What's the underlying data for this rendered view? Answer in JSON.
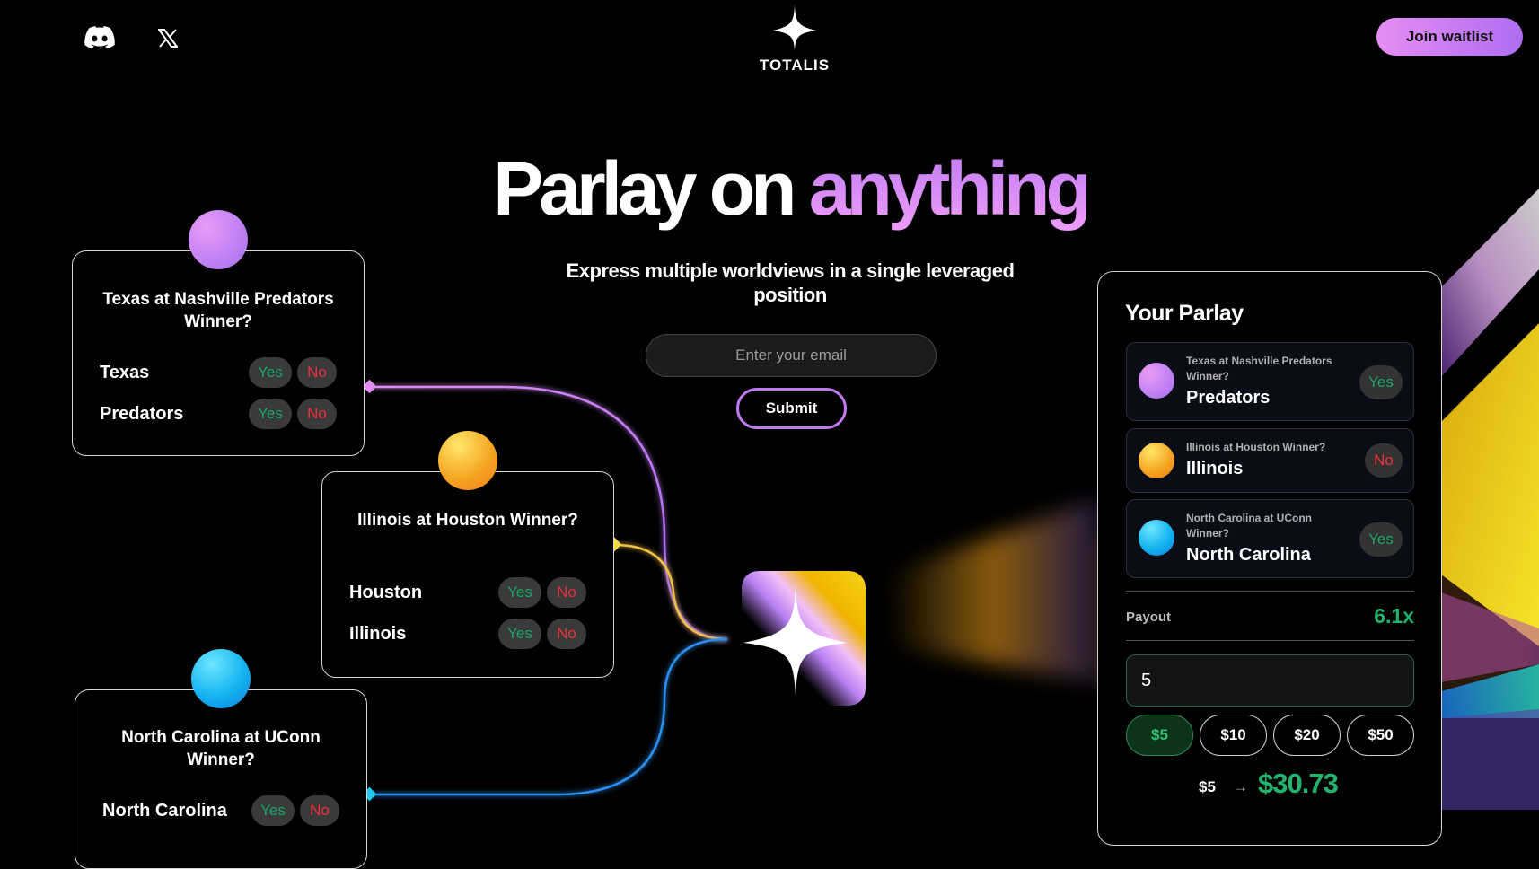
{
  "header": {
    "brand": "TOTALIS",
    "join_label": "Join waitlist",
    "icons": [
      "discord-icon",
      "x-icon"
    ]
  },
  "hero": {
    "title_main": "Parlay on ",
    "title_accent": "anything",
    "subtitle": "Express multiple worldviews in a single leveraged position",
    "email_placeholder": "Enter your email",
    "submit_label": "Submit"
  },
  "markets": [
    {
      "question": "Texas at Nashville Predators Winner?",
      "outcomes": [
        {
          "label": "Texas",
          "yes": "Yes",
          "no": "No"
        },
        {
          "label": "Predators",
          "yes": "Yes",
          "no": "No"
        }
      ]
    },
    {
      "question": "Illinois at Houston Winner?",
      "outcomes": [
        {
          "label": "Houston",
          "yes": "Yes",
          "no": "No"
        },
        {
          "label": "Illinois",
          "yes": "Yes",
          "no": "No"
        }
      ]
    },
    {
      "question": "North Carolina at UConn Winner?",
      "outcomes": [
        {
          "label": "North Carolina",
          "yes": "Yes",
          "no": "No"
        }
      ]
    }
  ],
  "parlay": {
    "title": "Your Parlay",
    "legs": [
      {
        "question": "Texas at Nashville Predators Winner?",
        "pick": "Predators",
        "side": "Yes"
      },
      {
        "question": "Illinois at Houston Winner?",
        "pick": "Illinois",
        "side": "No"
      },
      {
        "question": "North Carolina at UConn Winner?",
        "pick": "North Carolina",
        "side": "Yes"
      }
    ],
    "payout_label": "Payout",
    "payout_value": "6.1x",
    "amount": "5",
    "chips": [
      "$5",
      "$10",
      "$20",
      "$50"
    ],
    "selected_chip": "$5",
    "stake": "$5",
    "arrow": "→",
    "result": "$30.73"
  },
  "colors": {
    "accent_purple": "#c07af0",
    "yes_green": "#1aa567",
    "no_red": "#f02d3a",
    "payout_green": "#21b46b"
  }
}
